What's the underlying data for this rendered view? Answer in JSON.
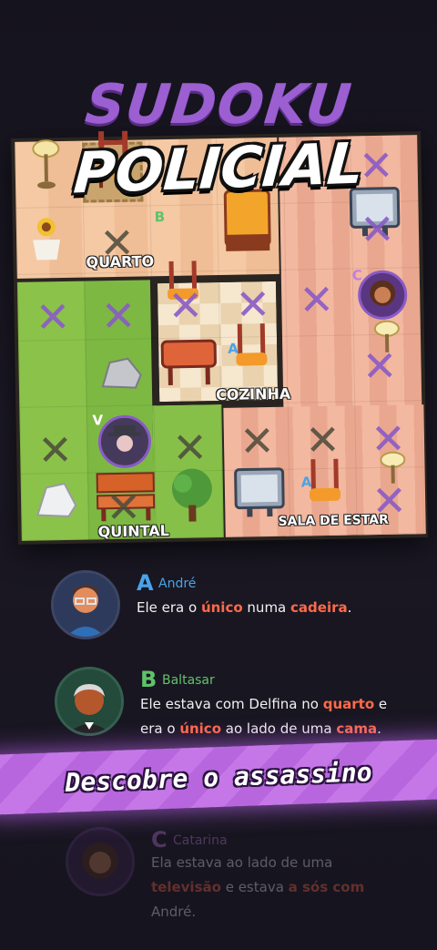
{
  "title": {
    "line1": "SUDOKU",
    "line2": "POLICIAL"
  },
  "rooms": {
    "quarto": "QUARTO",
    "cozinha": "COZINHA",
    "quintal": "QUINTAL",
    "sala": "SALA DE ESTAR"
  },
  "board_letters": {
    "b": "B",
    "c": "C",
    "a": "A",
    "a2": "A",
    "v": "V"
  },
  "suspects": [
    {
      "letter": "A",
      "name": "André",
      "letter_color": "#4aa3e8",
      "text_parts": [
        "Ele era o ",
        "único",
        " numa ",
        "cadeira",
        "."
      ]
    },
    {
      "letter": "B",
      "name": "Baltasar",
      "letter_color": "#5fc26b",
      "text_parts": [
        "Ele estava com Delfina no ",
        "quarto",
        " e era o ",
        "único",
        " ao lado de uma ",
        "cama",
        "."
      ]
    },
    {
      "letter": "C",
      "name": "Catarina",
      "letter_color": "#c07fe0",
      "text_parts": [
        "Ela estava ao lado de uma ",
        "televisão",
        " e estava ",
        "a sós com",
        " André."
      ]
    }
  ],
  "banner": {
    "label": "Descobre o assassino"
  },
  "colors": {
    "accent": "#9b5fd1",
    "highlight": "#ff6a4a",
    "banner": "#c577e8"
  }
}
